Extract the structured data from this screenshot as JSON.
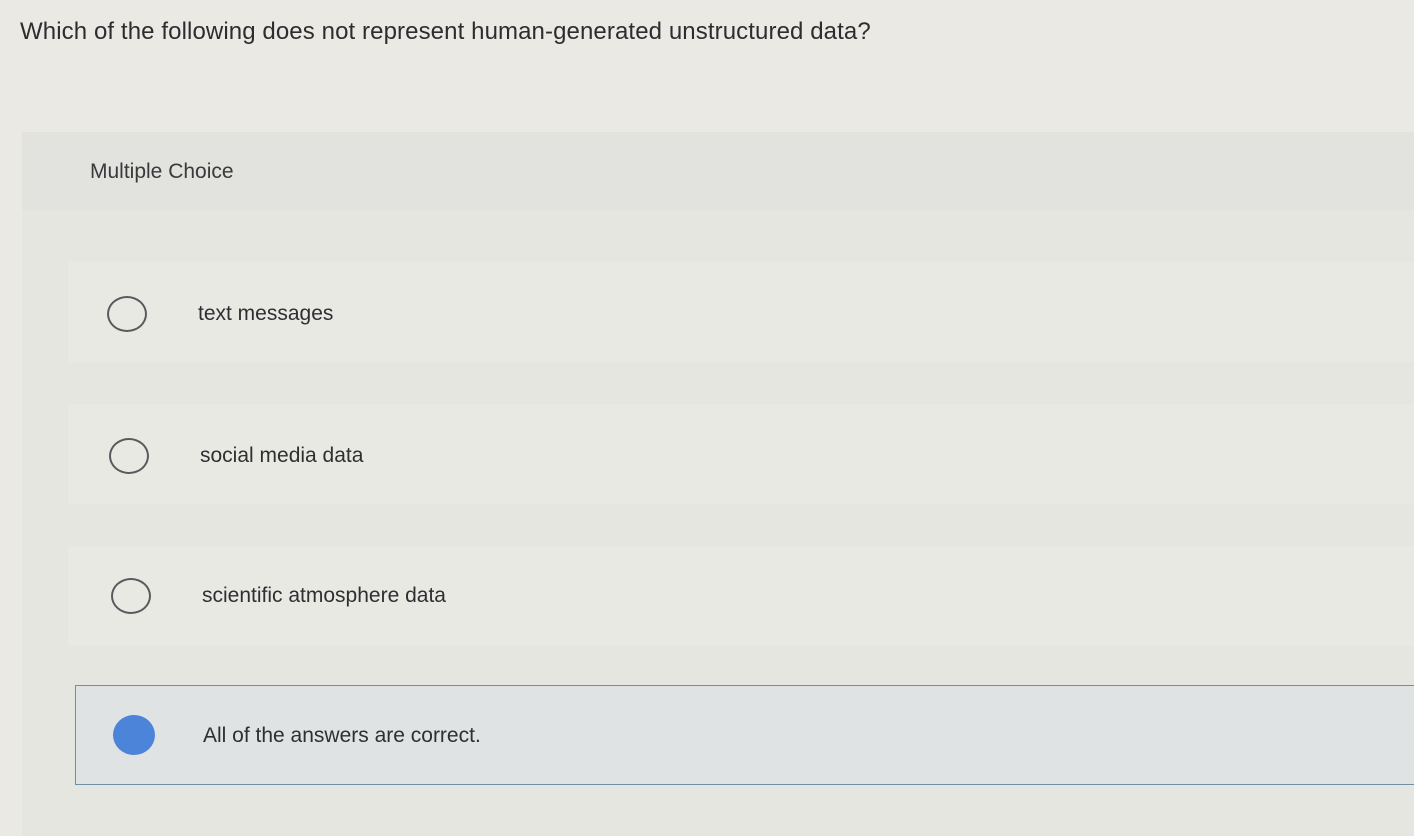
{
  "question": "Which of the following does not represent human-generated unstructured data?",
  "section_label": "Multiple Choice",
  "options": [
    {
      "label": "text messages",
      "selected": false
    },
    {
      "label": "social media data",
      "selected": false
    },
    {
      "label": "scientific atmosphere data",
      "selected": false
    },
    {
      "label": "All of the answers are correct.",
      "selected": true
    }
  ],
  "colors": {
    "selected_radio": "#4b84d8",
    "selected_border": "#6f8fa8"
  }
}
